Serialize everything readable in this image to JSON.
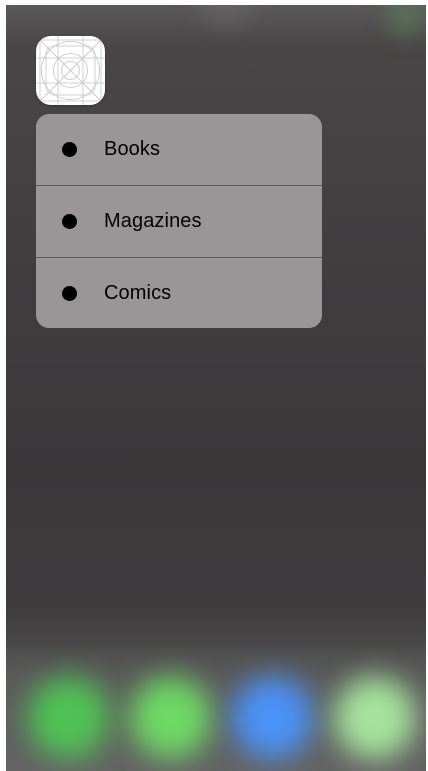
{
  "app_icon": {
    "icon": "app-placeholder-grid-icon"
  },
  "quick_actions": {
    "items": [
      {
        "label": "Books",
        "icon": "bullet-icon"
      },
      {
        "label": "Magazines",
        "icon": "bullet-icon"
      },
      {
        "label": "Comics",
        "icon": "bullet-icon"
      }
    ]
  },
  "dock": {
    "icon_colors": [
      "#4fc254",
      "#6ed865",
      "#4a92f7",
      "#a6e39d"
    ]
  },
  "colors": {
    "menu_background": "#9a9597",
    "menu_separator": "#5c5859",
    "wallpaper": "#3f3d3e"
  }
}
